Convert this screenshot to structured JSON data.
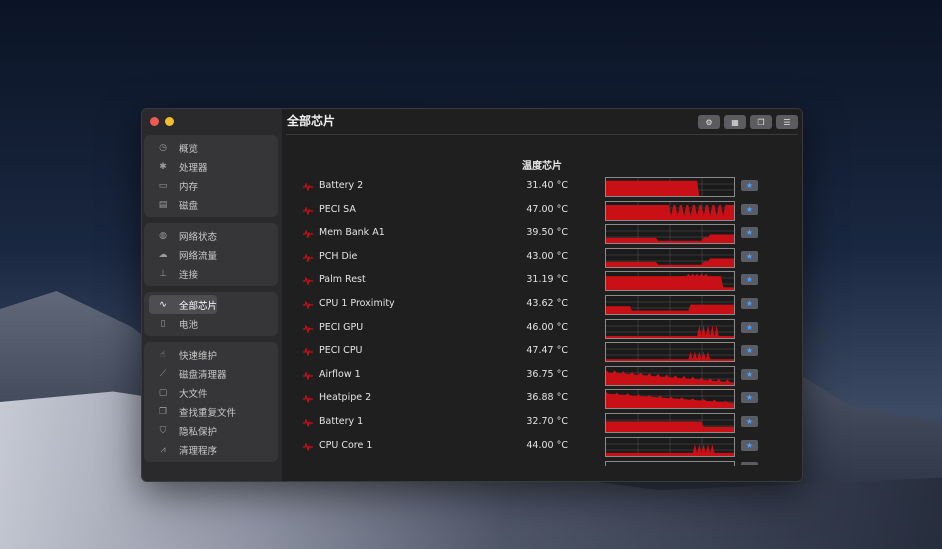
{
  "sidebar": {
    "groups": [
      [
        {
          "label": "概览",
          "icon": "dashboard-icon"
        },
        {
          "label": "处理器",
          "icon": "cpu-icon"
        },
        {
          "label": "内存",
          "icon": "memory-icon"
        },
        {
          "label": "磁盘",
          "icon": "disk-icon"
        }
      ],
      [
        {
          "label": "网络状态",
          "icon": "globe-icon"
        },
        {
          "label": "网络流量",
          "icon": "cloud-icon"
        },
        {
          "label": "连接",
          "icon": "network-tree-icon"
        }
      ],
      [
        {
          "label": "全部芯片",
          "icon": "pulse-icon",
          "active": true
        },
        {
          "label": "电池",
          "icon": "battery-icon"
        }
      ],
      [
        {
          "label": "快速维护",
          "icon": "hand-icon"
        },
        {
          "label": "磁盘清理器",
          "icon": "broom-icon"
        },
        {
          "label": "大文件",
          "icon": "file-icon"
        },
        {
          "label": "查找重复文件",
          "icon": "duplicate-icon"
        },
        {
          "label": "隐私保护",
          "icon": "shield-icon"
        },
        {
          "label": "清理程序",
          "icon": "app-cleaner-icon"
        }
      ]
    ]
  },
  "main": {
    "title": "全部芯片",
    "section_title": "温度芯片",
    "toolbar": [
      "gear-icon",
      "grid-icon",
      "windows-icon",
      "list-icon"
    ],
    "sensors": [
      {
        "name": "Battery 2",
        "value": "31.40 °C",
        "pattern": "battery2"
      },
      {
        "name": "PECI SA",
        "value": "47.00 °C",
        "pattern": "peci_sa"
      },
      {
        "name": "Mem Bank A1",
        "value": "39.50 °C",
        "pattern": "dip"
      },
      {
        "name": "PCH Die",
        "value": "43.00 °C",
        "pattern": "dip"
      },
      {
        "name": "Palm Rest",
        "value": "31.19 °C",
        "pattern": "palm"
      },
      {
        "name": "CPU 1 Proximity",
        "value": "43.62 °C",
        "pattern": "dip_high"
      },
      {
        "name": "PECI GPU",
        "value": "46.00 °C",
        "pattern": "low_spikes"
      },
      {
        "name": "PECI CPU",
        "value": "47.47 °C",
        "pattern": "low_spikes2"
      },
      {
        "name": "Airflow 1",
        "value": "36.75 °C",
        "pattern": "decay"
      },
      {
        "name": "Heatpipe 2",
        "value": "36.88 °C",
        "pattern": "decay2"
      },
      {
        "name": "Battery 1",
        "value": "32.70 °C",
        "pattern": "battery1"
      },
      {
        "name": "CPU Core 1",
        "value": "44.00 °C",
        "pattern": "low_spikes3"
      }
    ]
  },
  "colors": {
    "graph": "#c81016",
    "accent": "#4ba3ff"
  }
}
